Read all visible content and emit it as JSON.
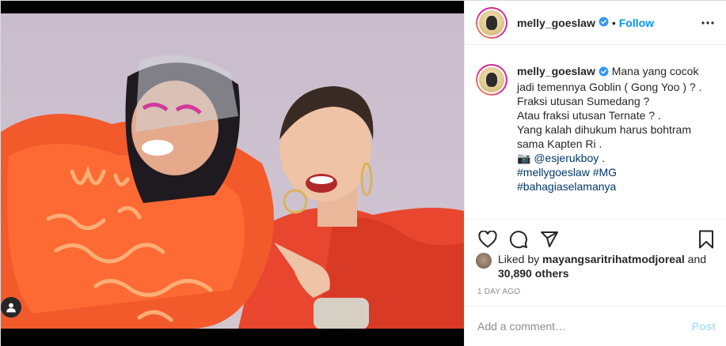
{
  "header": {
    "username": "melly_goeslaw",
    "separator": "•",
    "follow_label": "Follow"
  },
  "caption": {
    "username": "melly_goeslaw",
    "lines": [
      "Mana yang cocok",
      "jadi temennya Goblin ( Gong Yoo ) ? .",
      "Fraksi utusan Sumedang ?",
      "Atau fraksi utusan Ternate ? .",
      "Yang kalah dihukum harus bohtram",
      "sama Kapten Ri ."
    ],
    "camera_emoji": "📷",
    "mention": "@esjerukboy",
    "mention_suffix": " .",
    "hashtags_line1_a": "#mellygoeslaw",
    "hashtags_line1_b": "#MG",
    "hashtags_line2": "#bahagiaselamanya"
  },
  "likes": {
    "prefix": "Liked by ",
    "liker": "mayangsaritrihatmodjoreal",
    "conj": " and",
    "others_count": "30,890 others"
  },
  "timestamp": "1 day ago",
  "comment_box": {
    "placeholder": "Add a comment…",
    "post_label": "Post"
  },
  "icons": [
    "verified-badge-icon",
    "more-options-icon",
    "heart-icon",
    "comment-icon",
    "share-icon",
    "bookmark-icon",
    "user-tag-icon"
  ],
  "colors": {
    "link_blue": "#0095f6",
    "post_disabled": "#b2dffc",
    "hashtag": "#00376b",
    "muted": "#8e8e8e"
  }
}
